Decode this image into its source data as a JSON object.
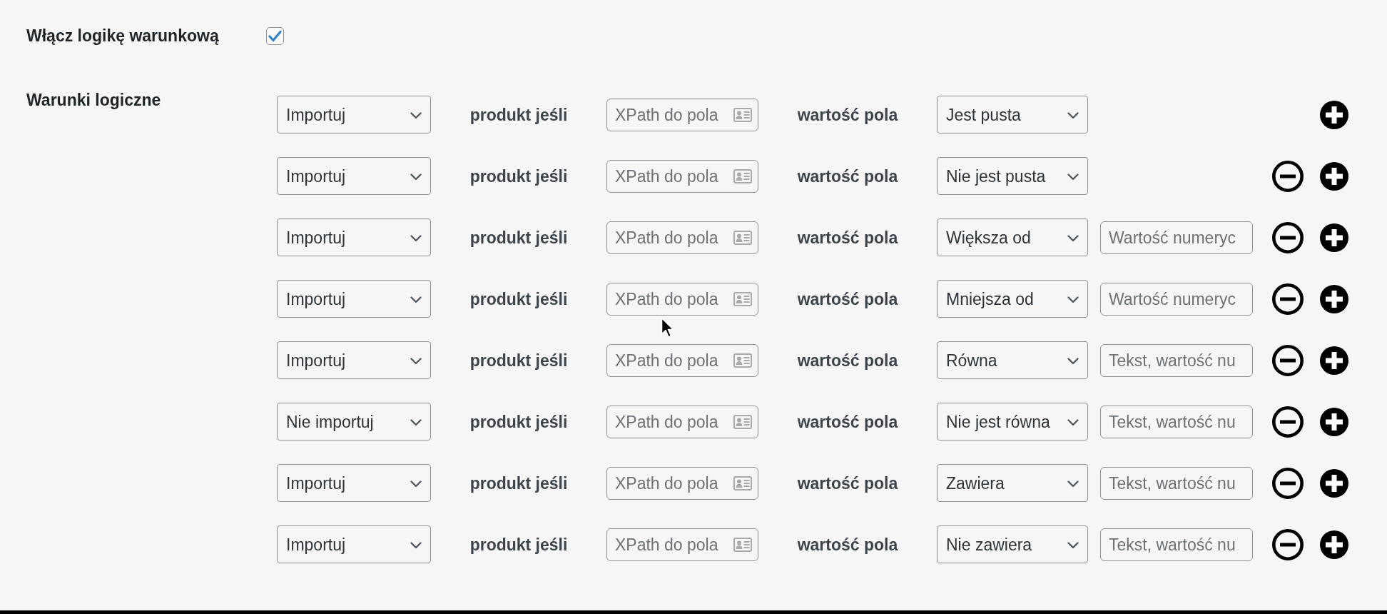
{
  "enable_logic": {
    "label": "Włącz logikę warunkową",
    "checked": true
  },
  "conditions": {
    "label": "Warunki logiczne",
    "rows": [
      {
        "action": "Importuj",
        "subject_label": "produkt jeśli",
        "xpath_placeholder": "XPath do pola",
        "value_label": "wartość pola",
        "operator": "Jest pusta",
        "removable": false
      },
      {
        "action": "Importuj",
        "subject_label": "produkt jeśli",
        "xpath_placeholder": "XPath do pola",
        "value_label": "wartość pola",
        "operator": "Nie jest pusta",
        "removable": true
      },
      {
        "action": "Importuj",
        "subject_label": "produkt jeśli",
        "xpath_placeholder": "XPath do pola",
        "value_label": "wartość pola",
        "operator": "Większa od",
        "value_placeholder": "Wartość numeryc",
        "removable": true
      },
      {
        "action": "Importuj",
        "subject_label": "produkt jeśli",
        "xpath_placeholder": "XPath do pola",
        "value_label": "wartość pola",
        "operator": "Mniejsza od",
        "value_placeholder": "Wartość numeryc",
        "removable": true
      },
      {
        "action": "Importuj",
        "subject_label": "produkt jeśli",
        "xpath_placeholder": "XPath do pola",
        "value_label": "wartość pola",
        "operator": "Równa",
        "value_placeholder": "Tekst, wartość nu",
        "removable": true
      },
      {
        "action": "Nie importuj",
        "subject_label": "produkt jeśli",
        "xpath_placeholder": "XPath do pola",
        "value_label": "wartość pola",
        "operator": "Nie jest równa",
        "value_placeholder": "Tekst, wartość nu",
        "removable": true
      },
      {
        "action": "Importuj",
        "subject_label": "produkt jeśli",
        "xpath_placeholder": "XPath do pola",
        "value_label": "wartość pola",
        "operator": "Zawiera",
        "value_placeholder": "Tekst, wartość nu",
        "removable": true
      },
      {
        "action": "Importuj",
        "subject_label": "produkt jeśli",
        "xpath_placeholder": "XPath do pola",
        "value_label": "wartość pola",
        "operator": "Nie zawiera",
        "value_placeholder": "Tekst, wartość nu",
        "removable": true
      }
    ]
  }
}
